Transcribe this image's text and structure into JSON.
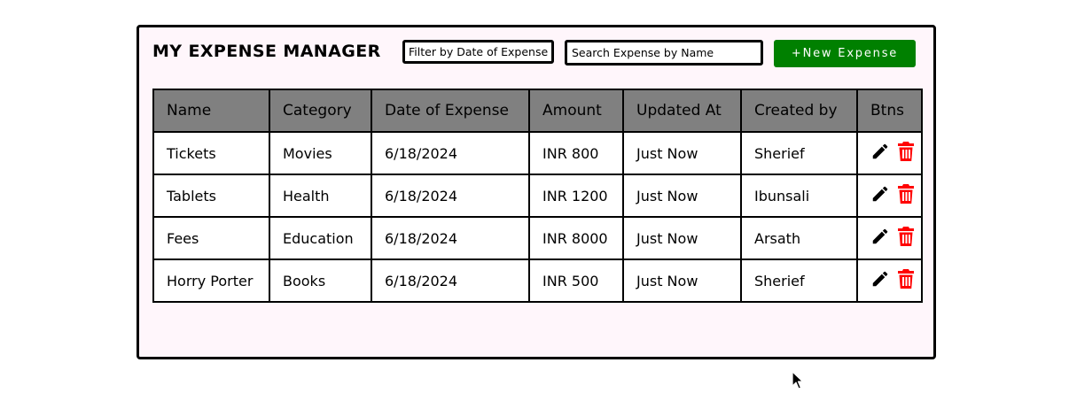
{
  "app": {
    "title": "MY EXPENSE MANAGER",
    "filter_placeholder": "Filter by Date of Expense",
    "search_placeholder": "Search Expense by Name",
    "new_button": "+New Expense"
  },
  "colors": {
    "new_button": "#008000",
    "header_bg": "#808080",
    "delete_icon": "#ff0000",
    "card_bg": "#fff6fb"
  },
  "table": {
    "headers": [
      "Name",
      "Category",
      "Date of Expense",
      "Amount",
      "Updated At",
      "Created by",
      "Btns"
    ],
    "rows": [
      [
        "Tickets",
        "Movies",
        "6/18/2024",
        "INR 800",
        "Just Now",
        "Sherief"
      ],
      [
        "Tablets",
        "Health",
        "6/18/2024",
        "INR 1200",
        "Just Now",
        "Ibunsali"
      ],
      [
        "Fees",
        "Education",
        "6/18/2024",
        "INR 8000",
        "Just Now",
        "Arsath"
      ],
      [
        "Horry Porter",
        "Books",
        "6/18/2024",
        "INR 500",
        "Just Now",
        "Sherief"
      ]
    ],
    "row_action_icons": [
      "pencil-icon",
      "trash-icon"
    ]
  }
}
